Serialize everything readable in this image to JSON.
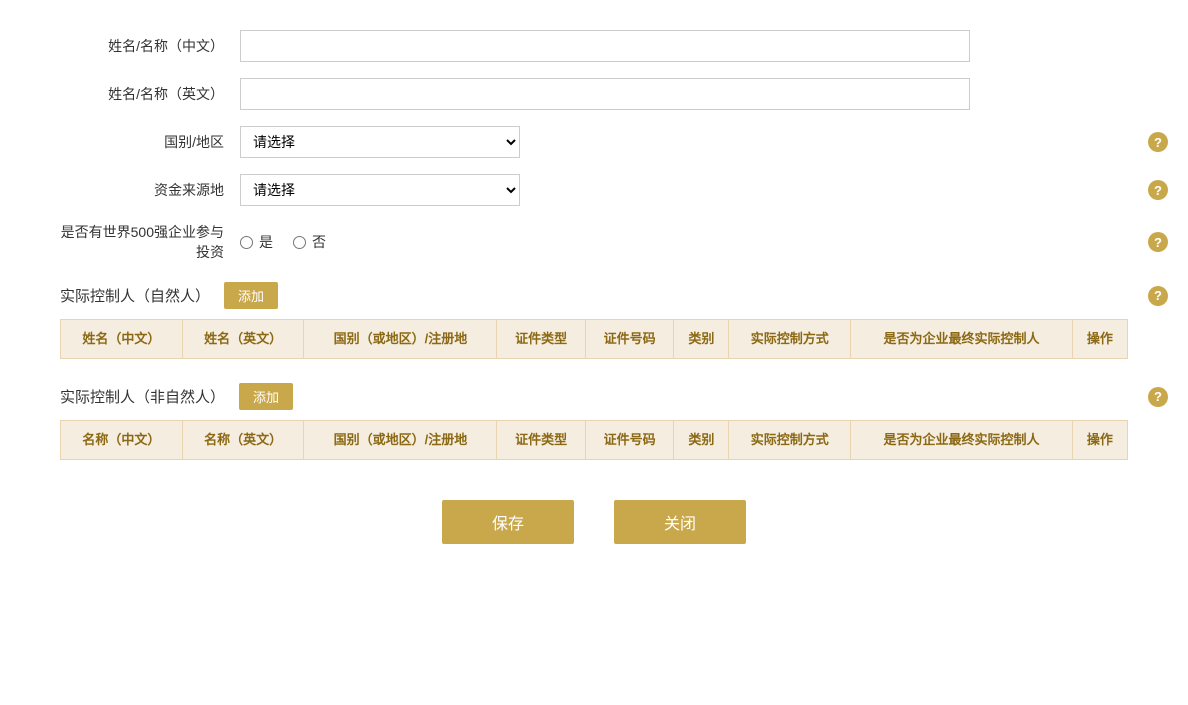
{
  "form": {
    "name_cn_label": "姓名/名称（中文）",
    "name_cn_placeholder": "",
    "name_en_label": "姓名/名称（英文）",
    "name_en_placeholder": "",
    "country_label": "国别/地区",
    "country_placeholder": "请选择",
    "fund_source_label": "资金来源地",
    "fund_source_placeholder": "请选择",
    "fortune500_label": "是否有世界500强企业参与投资",
    "radio_yes": "是",
    "radio_no": "否"
  },
  "section1": {
    "title": "实际控制人（自然人）",
    "add_label": "添加",
    "headers": [
      "姓名（中文）",
      "姓名（英文）",
      "国别（或地区）/注册地",
      "证件类型",
      "证件号码",
      "类别",
      "实际控制方式",
      "是否为企业最终实际控制人",
      "操作"
    ]
  },
  "section2": {
    "title": "实际控制人（非自然人）",
    "add_label": "添加",
    "headers": [
      "名称（中文）",
      "名称（英文）",
      "国别（或地区）/注册地",
      "证件类型",
      "证件号码",
      "类别",
      "实际控制方式",
      "是否为企业最终实际控制人",
      "操作"
    ]
  },
  "buttons": {
    "save": "保存",
    "close": "关闭"
  },
  "help_icon": "?",
  "colors": {
    "gold": "#c9a84c",
    "table_header_bg": "#f5ede0",
    "table_header_text": "#8b6914",
    "table_border": "#e8d5b0"
  }
}
